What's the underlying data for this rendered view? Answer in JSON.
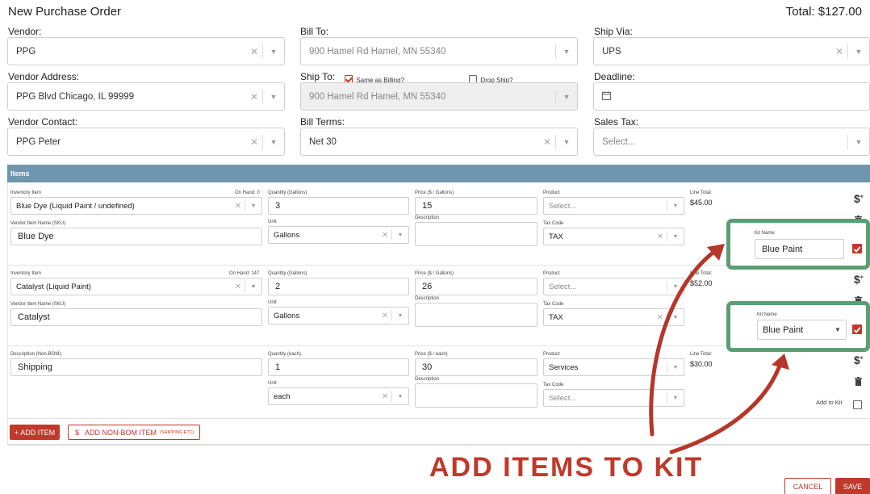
{
  "header": {
    "title": "New Purchase Order",
    "total": "Total: $127.00"
  },
  "vendor": {
    "label": "Vendor:",
    "value": "PPG"
  },
  "bill_to": {
    "label": "Bill To:",
    "value": "900 Hamel Rd Hamel, MN 55340"
  },
  "ship_via": {
    "label": "Ship Via:",
    "value": "UPS"
  },
  "vendor_address": {
    "label": "Vendor Address:",
    "value": "PPG Blvd Chicago, IL 99999"
  },
  "ship_to": {
    "label": "Ship To:",
    "same_as_billing": "Same as Billing?",
    "drop_ship": "Drop Ship?",
    "value": "900 Hamel Rd Hamel, MN 55340"
  },
  "deadline": {
    "label": "Deadline:"
  },
  "vendor_contact": {
    "label": "Vendor Contact:",
    "value": "PPG Peter"
  },
  "bill_terms": {
    "label": "Bill Terms:",
    "value": "Net 30"
  },
  "sales_tax": {
    "label": "Sales Tax:",
    "placeholder": "Select..."
  },
  "items": {
    "header": "Items",
    "rows": [
      {
        "inv_label": "Inventory Item",
        "on_hand": "On Hand: 0",
        "inv_value": "Blue Dye (Liquid Paint / undefined)",
        "sku_label": "Vendor Item Name (SKU)",
        "sku_value": "Blue Dye",
        "qty_label": "Quantity (Gallons)",
        "qty_value": "3",
        "unit_label": "Unit",
        "unit_value": "Gallons",
        "price_label": "Price ($ / Gallons)",
        "price_value": "15",
        "desc_label": "Description",
        "desc_value": "",
        "product_label": "Product",
        "product_value": "Select...",
        "tax_label": "Tax Code",
        "tax_value": "TAX",
        "line_label": "Line Total:",
        "line_value": "$45.00"
      },
      {
        "inv_label": "Inventory Item",
        "on_hand": "On Hand: 147",
        "inv_value": "Catalyst (Liquid Paint)",
        "sku_label": "Vendor Item Name (SKU)",
        "sku_value": "Catalyst",
        "qty_label": "Quantity (Gallons)",
        "qty_value": "2",
        "unit_label": "Unit",
        "unit_value": "Gallons",
        "price_label": "Price ($ / Gallons)",
        "price_value": "26",
        "desc_label": "Description",
        "desc_value": "",
        "product_label": "Product",
        "product_value": "Select...",
        "tax_label": "Tax Code",
        "tax_value": "TAX",
        "line_label": "Line Total:",
        "line_value": "$52.00"
      },
      {
        "inv_label": "Description (Non-BOM):",
        "inv_value": "Shipping",
        "qty_label": "Quantity (each)",
        "qty_value": "1",
        "unit_label": "Unit",
        "unit_value": "each",
        "price_label": "Price ($ / each)",
        "price_value": "30",
        "desc_label": "Description",
        "desc_value": "",
        "product_label": "Product",
        "product_value": "Services",
        "tax_label": "Tax Code",
        "tax_value": "Select...",
        "line_label": "Line Total:",
        "line_value": "$30.00",
        "add_to_kit": "Add to Kit"
      }
    ],
    "kit": [
      {
        "label": "Kit Name",
        "value": "Blue Paint"
      },
      {
        "label": "Kit Name",
        "value": "Blue Paint"
      }
    ]
  },
  "buttons": {
    "add_item": "+ ADD ITEM",
    "add_non_bom": "ADD NON-BOM ITEM",
    "add_non_bom_note": "(SHIPPING ETC)",
    "cancel": "CANCEL",
    "save": "SAVE"
  },
  "annotation": "ADD ITEMS TO KIT",
  "colors": {
    "accent": "#c0392b",
    "items_bar": "#6f96ae",
    "kit_border": "#5b9e74"
  }
}
